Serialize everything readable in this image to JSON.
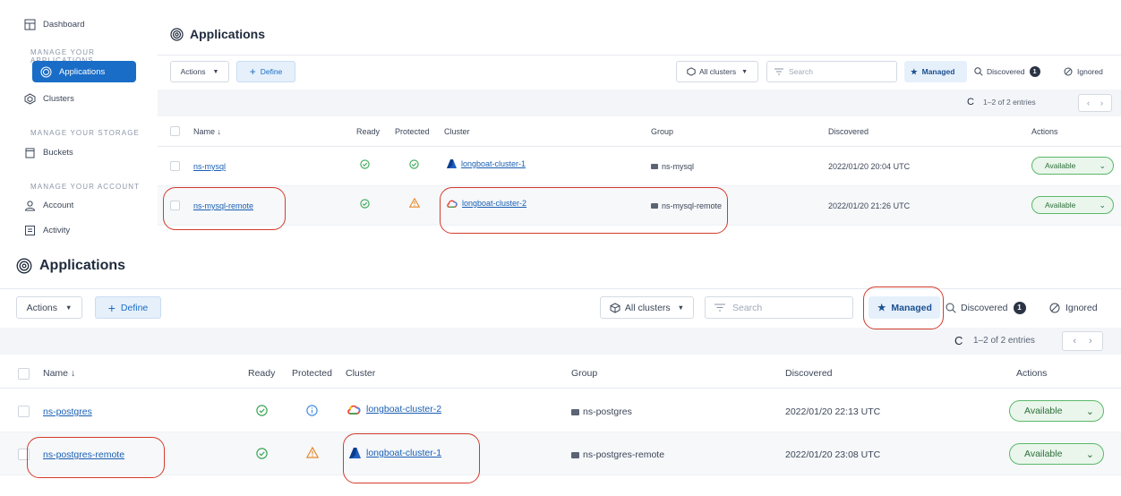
{
  "sidebar": {
    "items": [
      {
        "label": "Dashboard"
      },
      {
        "label": "Applications"
      },
      {
        "label": "Clusters"
      },
      {
        "label": "Buckets"
      },
      {
        "label": "Account"
      },
      {
        "label": "Activity"
      }
    ],
    "sections": {
      "apps": "MANAGE YOUR APPLICATIONS",
      "storage": "MANAGE YOUR STORAGE",
      "account": "MANAGE YOUR ACCOUNT"
    }
  },
  "page": {
    "title": "Applications",
    "actions_label": "Actions",
    "define_label": "Define",
    "clusters_filter": "All clusters",
    "search_placeholder": "Search",
    "filters": {
      "managed": "Managed",
      "discovered": "Discovered",
      "discovered_count": "1",
      "ignored": "Ignored"
    },
    "entries": "1–2 of 2 entries"
  },
  "columns": {
    "name": "Name",
    "ready": "Ready",
    "protected": "Protected",
    "cluster": "Cluster",
    "group": "Group",
    "discovered": "Discovered",
    "actions": "Actions"
  },
  "top_rows": [
    {
      "name": "ns-mysql",
      "cluster": "longboat-cluster-1",
      "group": "ns-mysql",
      "discovered": "2022/01/20 20:04 UTC",
      "status": "Available",
      "protected_icon": "check-circle-icon",
      "cluster_icon": "azure-icon"
    },
    {
      "name": "ns-mysql-remote",
      "cluster": "longboat-cluster-2",
      "group": "ns-mysql-remote",
      "discovered": "2022/01/20 21:26 UTC",
      "status": "Available",
      "protected_icon": "warning-icon",
      "cluster_icon": "gcp-icon"
    }
  ],
  "bottom_rows": [
    {
      "name": "ns-postgres",
      "cluster": "longboat-cluster-2",
      "group": "ns-postgres",
      "discovered": "2022/01/20 22:13 UTC",
      "status": "Available",
      "protected_icon": "info-icon",
      "cluster_icon": "gcp-icon"
    },
    {
      "name": "ns-postgres-remote",
      "cluster": "longboat-cluster-1",
      "group": "ns-postgres-remote",
      "discovered": "2022/01/20 23:08 UTC",
      "status": "Available",
      "protected_icon": "warning-icon",
      "cluster_icon": "azure-icon"
    }
  ],
  "colors": {
    "accent": "#1a6dc7",
    "ready_green": "#3aa655",
    "warning_orange": "#e8892b",
    "info_blue": "#4a8fe0",
    "annotation_red": "#d43b2b"
  }
}
